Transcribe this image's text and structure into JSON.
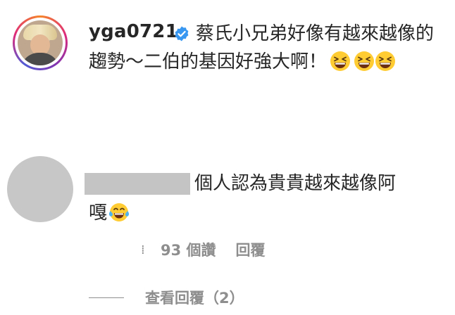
{
  "post": {
    "username": "yga0721",
    "verified": true,
    "caption": "蔡氏小兄弟好像有越來越像的趨勢～二伯的基因好強大啊！",
    "emojis": [
      "grinning-squinting-face",
      "grinning-squinting-face",
      "grinning-squinting-face"
    ]
  },
  "comment": {
    "username_redacted": true,
    "text": "個人認為貴貴越來越像阿嘎",
    "emoji": "face-with-tears-of-joy",
    "likes_text": "93 個讚",
    "reply_label": "回覆",
    "view_replies_label": "查看回覆（2）"
  },
  "colors": {
    "text": "#262626",
    "secondary": "#8e8e8e",
    "verified_blue": "#3897f0",
    "placeholder_gray": "#c7c7c7"
  }
}
